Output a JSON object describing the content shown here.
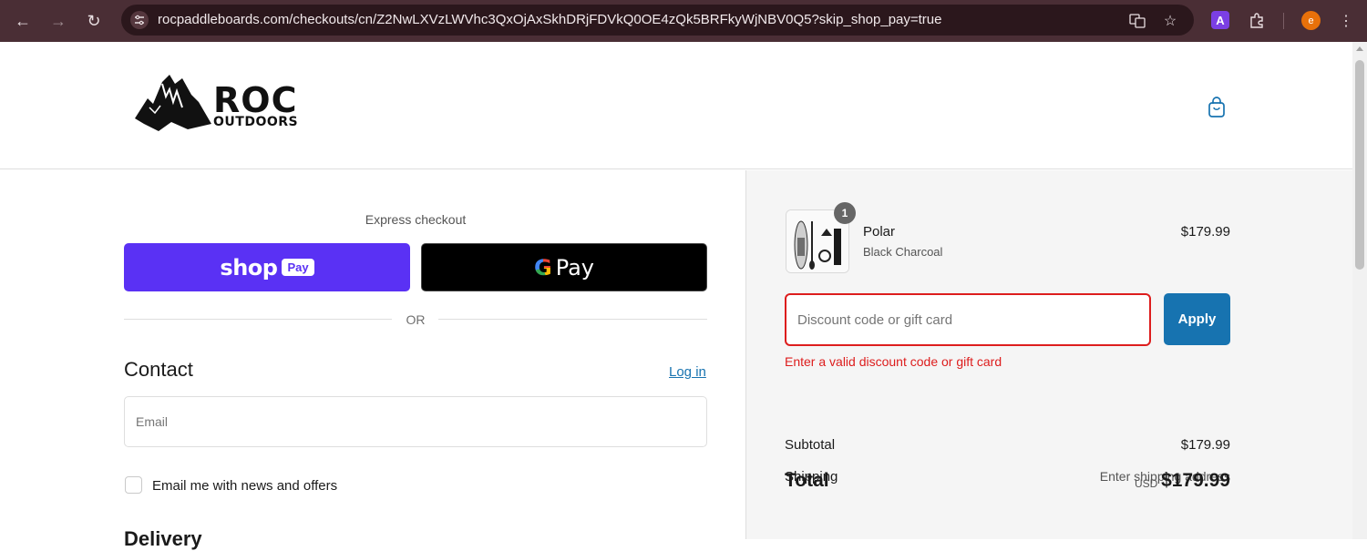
{
  "browser": {
    "url": "rocpaddleboards.com/checkouts/cn/Z2NwLXVzLWVhc3QxOjAxSkhDRjFDVkQ0OE4zQk5BRFkyWjNBV0Q5?skip_shop_pay=true",
    "extension_badge": "A",
    "profile_initial": "e"
  },
  "store": {
    "logo_line1": "ROC",
    "logo_line2": "OUTDOORS"
  },
  "express": {
    "label": "Express checkout",
    "shop_word": "shop",
    "shop_badge": "Pay",
    "gpay_letter": "G",
    "gpay_word": "Pay",
    "or": "OR"
  },
  "contact": {
    "heading": "Contact",
    "login": "Log in",
    "email_placeholder": "Email",
    "newsletter": "Email me with news and offers"
  },
  "delivery": {
    "heading": "Delivery"
  },
  "summary": {
    "item": {
      "qty": "1",
      "name": "Polar",
      "variant": "Black Charcoal",
      "price": "$179.99"
    },
    "discount_placeholder": "Discount code or gift card",
    "apply": "Apply",
    "error": "Enter a valid discount code or gift card",
    "subtotal_label": "Subtotal",
    "subtotal_value": "$179.99",
    "shipping_label": "Shipping",
    "shipping_value": "Enter shipping address",
    "total_label": "Total",
    "currency": "USD",
    "total_value": "$179.99"
  },
  "colors": {
    "accent": "#1773b0",
    "error": "#dd1d1d",
    "shop_pay": "#5a31f4"
  }
}
